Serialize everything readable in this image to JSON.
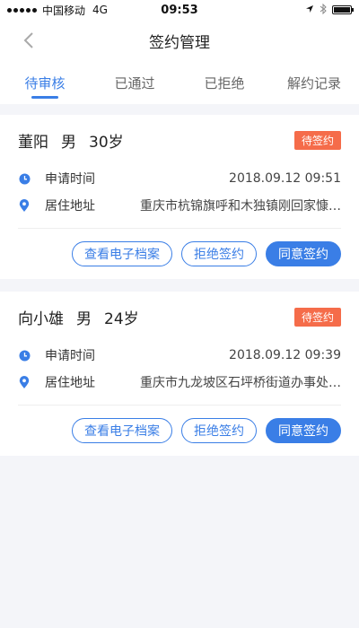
{
  "status": {
    "carrier": "中国移动",
    "network": "4G",
    "time": "09:53"
  },
  "nav": {
    "title": "签约管理"
  },
  "tabs": [
    {
      "label": "待审核"
    },
    {
      "label": "已通过"
    },
    {
      "label": "已拒绝"
    },
    {
      "label": "解约记录"
    }
  ],
  "cards": [
    {
      "name": "董阳",
      "gender": "男",
      "age": "30岁",
      "badge": "待签约",
      "apply_label": "申请时间",
      "apply_time": "2018.09.12 09:51",
      "addr_label": "居住地址",
      "address": "重庆市杭锦旗呼和木独镇刚回家慷…",
      "btn_profile": "查看电子档案",
      "btn_reject": "拒绝签约",
      "btn_agree": "同意签约"
    },
    {
      "name": "向小雄",
      "gender": "男",
      "age": "24岁",
      "badge": "待签约",
      "apply_label": "申请时间",
      "apply_time": "2018.09.12 09:39",
      "addr_label": "居住地址",
      "address": "重庆市九龙坡区石坪桥街道办事处…",
      "btn_profile": "查看电子档案",
      "btn_reject": "拒绝签约",
      "btn_agree": "同意签约"
    }
  ],
  "colors": {
    "accent": "#3a7ee6",
    "badge": "#f56c4a"
  }
}
